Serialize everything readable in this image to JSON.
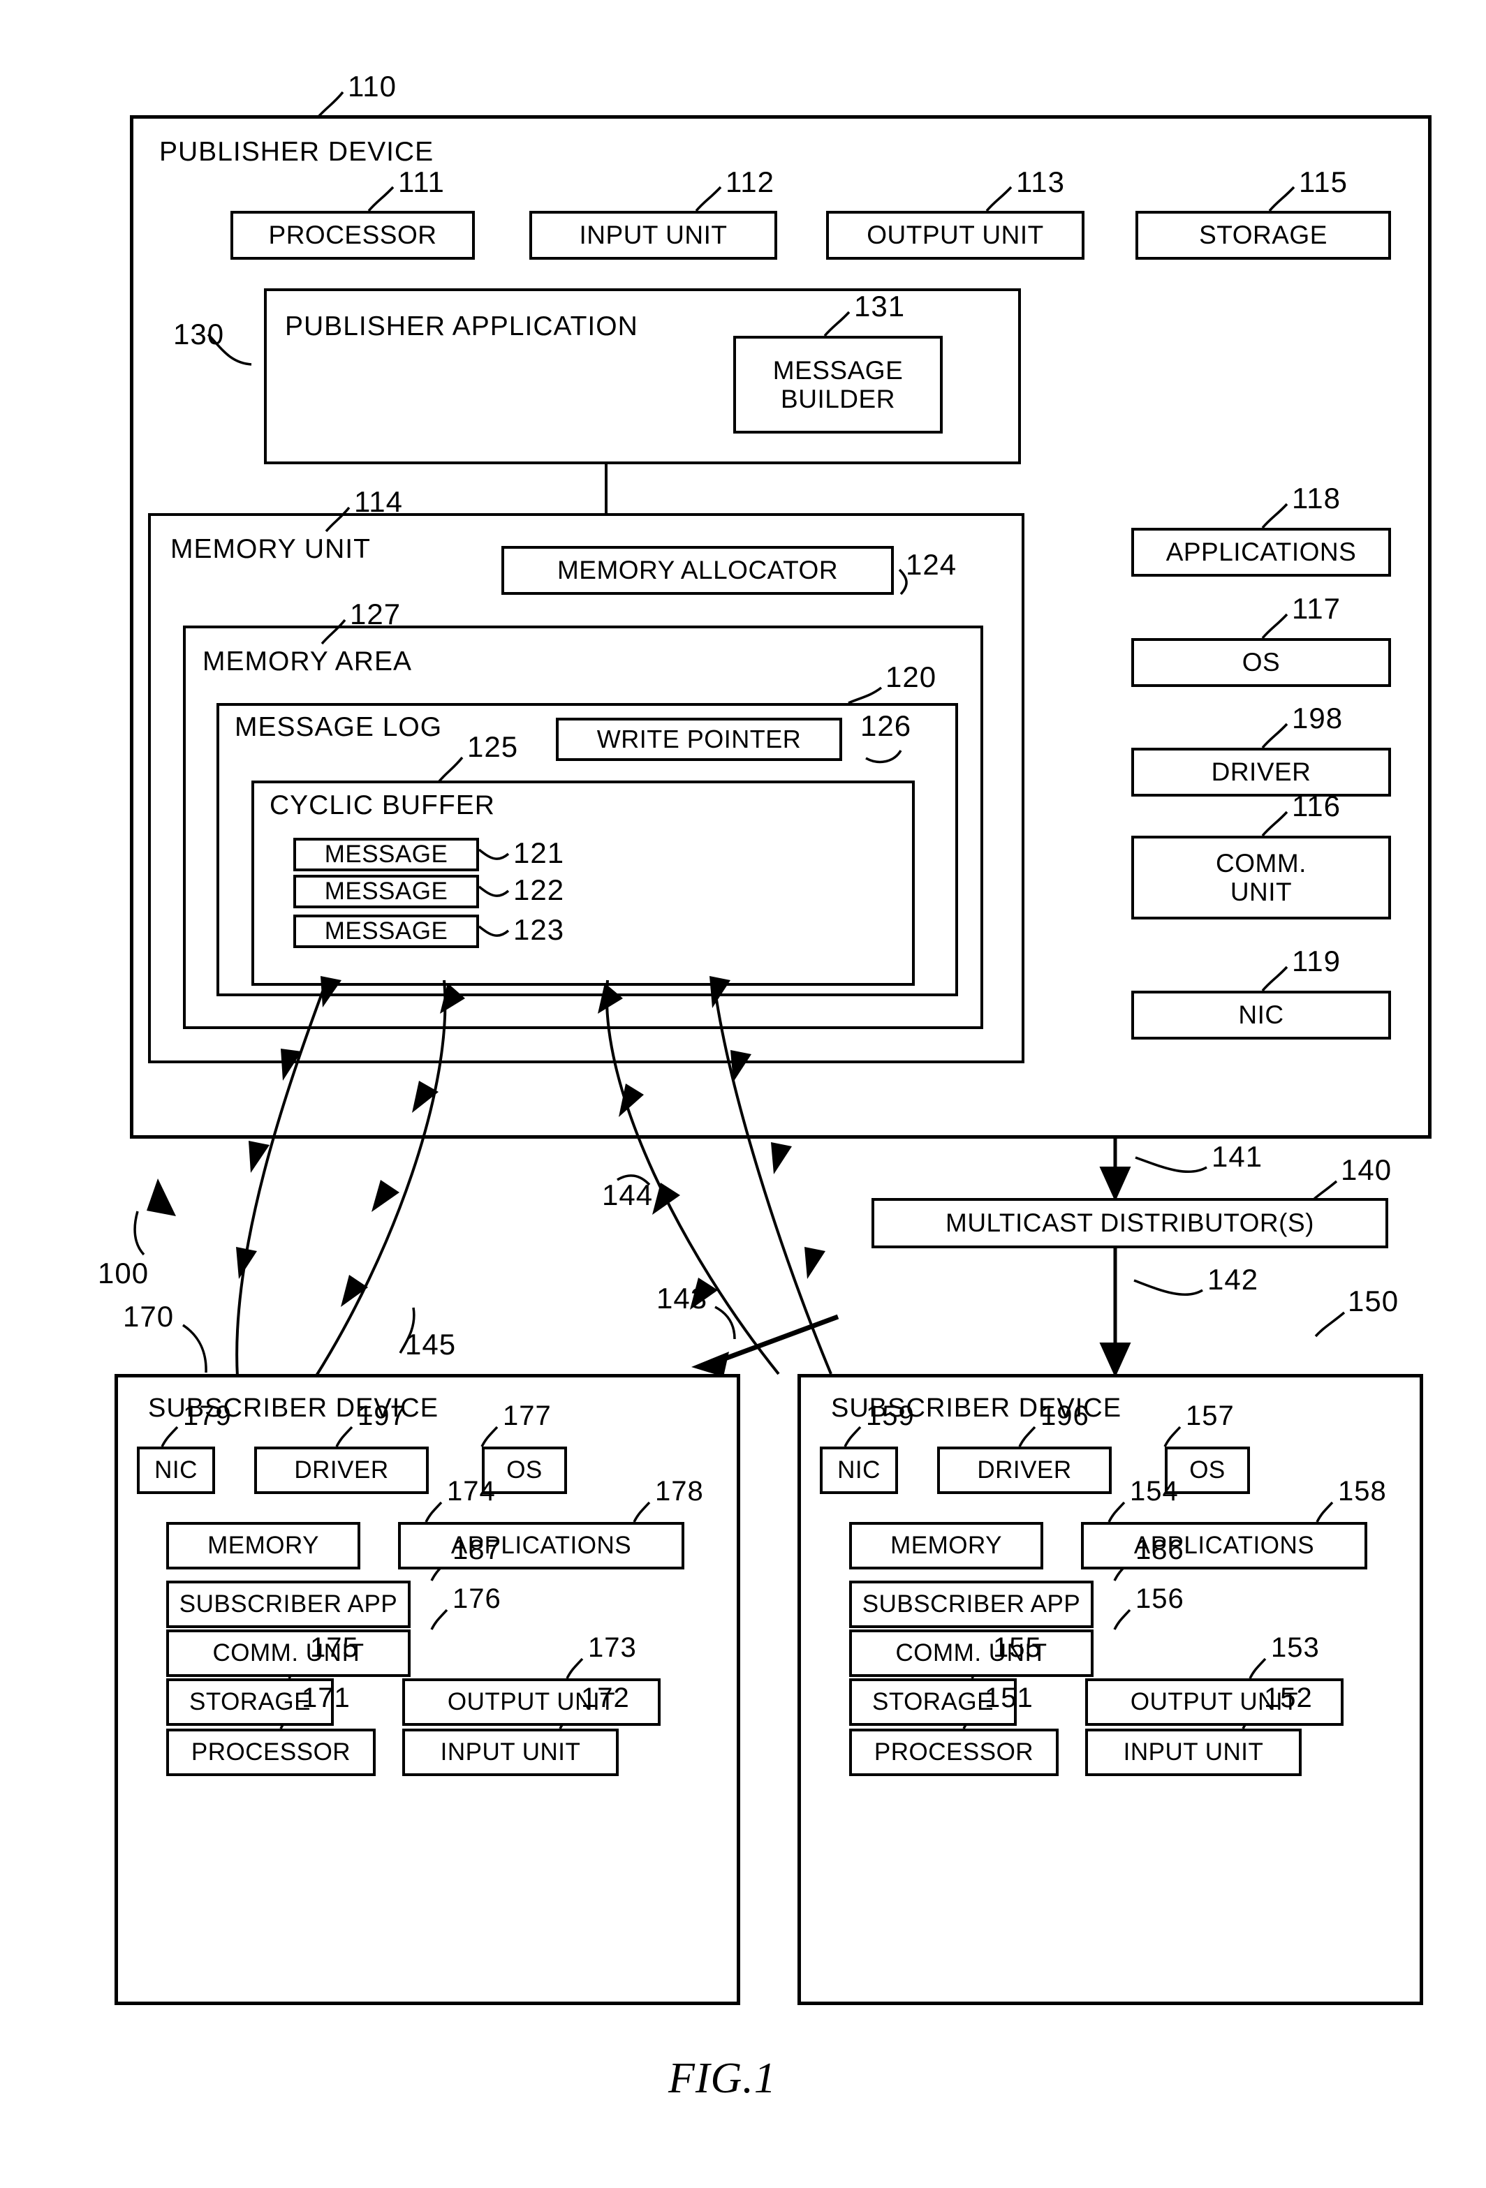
{
  "figure": {
    "label": "FIG.1",
    "system_ref": "100"
  },
  "publisher": {
    "title": "PUBLISHER DEVICE",
    "ref": "110",
    "top_row": [
      {
        "label": "PROCESSOR",
        "ref": "111"
      },
      {
        "label": "INPUT UNIT",
        "ref": "112"
      },
      {
        "label": "OUTPUT UNIT",
        "ref": "113"
      },
      {
        "label": "STORAGE",
        "ref": "115"
      }
    ],
    "application": {
      "title": "PUBLISHER APPLICATION",
      "ref": "130",
      "message_builder": {
        "line1": "MESSAGE",
        "line2": "BUILDER",
        "ref": "131"
      }
    },
    "memory_unit": {
      "title": "MEMORY UNIT",
      "ref": "114",
      "memory_allocator": {
        "label": "MEMORY ALLOCATOR",
        "ref": "124"
      },
      "memory_area": {
        "title": "MEMORY AREA",
        "ref": "127",
        "message_log": {
          "title": "MESSAGE LOG",
          "ref": "120",
          "write_pointer": {
            "label": "WRITE POINTER",
            "ref": "126"
          },
          "cyclic_buffer": {
            "title": "CYCLIC BUFFER",
            "ref": "125",
            "messages": [
              {
                "label": "MESSAGE",
                "ref": "121"
              },
              {
                "label": "MESSAGE",
                "ref": "122"
              },
              {
                "label": "MESSAGE",
                "ref": "123"
              }
            ]
          }
        }
      }
    },
    "stack": [
      {
        "label": "APPLICATIONS",
        "ref": "118"
      },
      {
        "label": "OS",
        "ref": "117"
      },
      {
        "label": "DRIVER",
        "ref": "198"
      },
      {
        "label": "COMM. UNIT",
        "line1": "COMM.",
        "line2": "UNIT",
        "ref": "116"
      },
      {
        "label": "NIC",
        "ref": "119"
      }
    ]
  },
  "multicast": {
    "label": "MULTICAST DISTRIBUTOR(S)",
    "ref": "140",
    "inbound_ref": "141",
    "outbound_ref": "142"
  },
  "flows": [
    {
      "ref": "143"
    },
    {
      "ref": "144"
    },
    {
      "ref": "145"
    }
  ],
  "subscriber_left": {
    "title": "SUBSCRIBER DEVICE",
    "ref": "170",
    "components": [
      {
        "label": "NIC",
        "ref": "179"
      },
      {
        "label": "DRIVER",
        "ref": "197"
      },
      {
        "label": "OS",
        "ref": "177"
      },
      {
        "label": "MEMORY",
        "ref": "174"
      },
      {
        "label": "APPLICATIONS",
        "ref": "178"
      },
      {
        "label": "SUBSCRIBER APP",
        "ref": "187"
      },
      {
        "label": "COMM. UNIT",
        "ref": "176"
      },
      {
        "label": "STORAGE",
        "ref": "175"
      },
      {
        "label": "OUTPUT UNIT",
        "ref": "173"
      },
      {
        "label": "PROCESSOR",
        "ref": "171"
      },
      {
        "label": "INPUT UNIT",
        "ref": "172"
      }
    ]
  },
  "subscriber_right": {
    "title": "SUBSCRIBER DEVICE",
    "ref": "150",
    "components": [
      {
        "label": "NIC",
        "ref": "159"
      },
      {
        "label": "DRIVER",
        "ref": "196"
      },
      {
        "label": "OS",
        "ref": "157"
      },
      {
        "label": "MEMORY",
        "ref": "154"
      },
      {
        "label": "APPLICATIONS",
        "ref": "158"
      },
      {
        "label": "SUBSCRIBER APP",
        "ref": "186"
      },
      {
        "label": "COMM. UNIT",
        "ref": "156"
      },
      {
        "label": "STORAGE",
        "ref": "155"
      },
      {
        "label": "OUTPUT UNIT",
        "ref": "153"
      },
      {
        "label": "PROCESSOR",
        "ref": "151"
      },
      {
        "label": "INPUT UNIT",
        "ref": "152"
      }
    ]
  }
}
